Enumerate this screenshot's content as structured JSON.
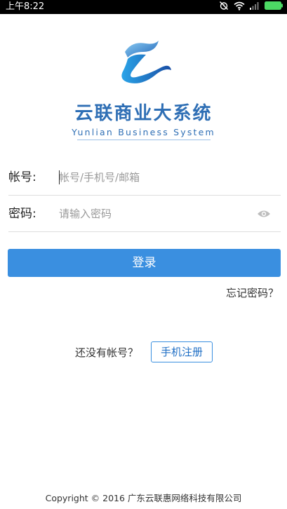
{
  "status_bar": {
    "time": "上午8:22",
    "icons": [
      "alarm-off-icon",
      "wifi-icon",
      "cell-signal-icon",
      "battery-icon"
    ],
    "battery_color": "#4cd964"
  },
  "header": {
    "logo_name": "yunlian-logo",
    "title": "云联商业大系统",
    "subtitle": "Yunlian Business System",
    "brand_color": "#2f6fb5"
  },
  "form": {
    "account": {
      "label": "帐号:",
      "placeholder": "帐号/手机号/邮箱",
      "value": ""
    },
    "password": {
      "label": "密码:",
      "placeholder": "请输入密码",
      "value": "",
      "toggle_icon": "eye-icon"
    }
  },
  "actions": {
    "login_label": "登录",
    "login_color": "#3a8fe0",
    "forgot_label": "忘记密码？"
  },
  "register": {
    "prompt": "还没有帐号？",
    "button_label": "手机注册"
  },
  "footer": {
    "copyright": "Copyright © 2016 广东云联惠网络科技有限公司"
  }
}
